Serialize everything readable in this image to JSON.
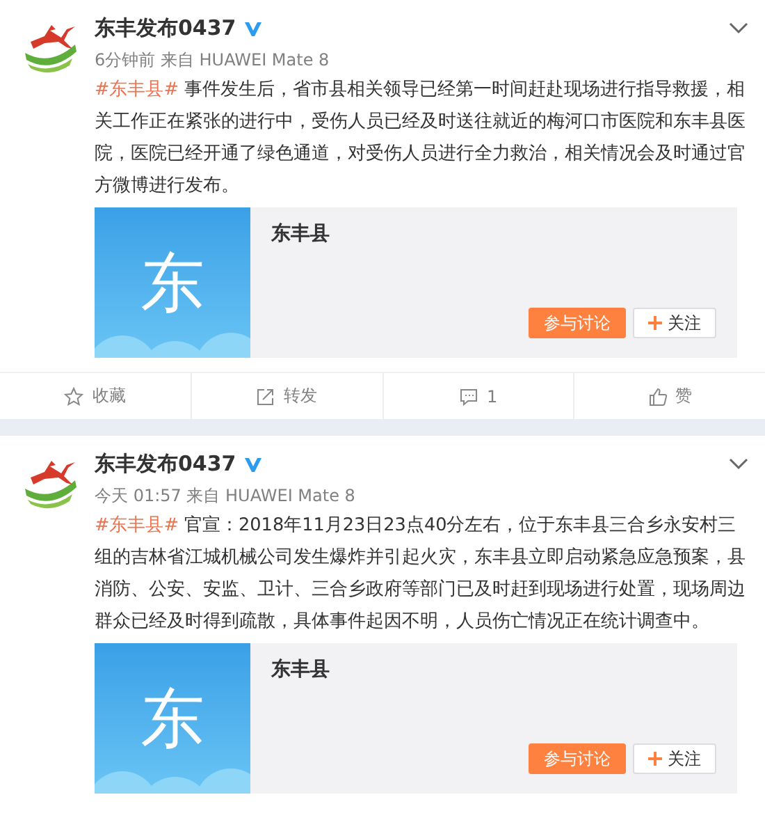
{
  "posts": [
    {
      "author": "东丰发布0437",
      "verified": true,
      "meta": "6分钟前 来自 HUAWEI Mate 8",
      "topic": "#东丰县#",
      "text": " 事件发生后，省市县相关领导已经第一时间赶赴现场进行指导救援，相关工作正在紧张的进行中，受伤人员已经及时送往就近的梅河口市医院和东丰县医院，医院已经开通了绿色通道，对受伤人员进行全力救治，相关情况会及时通过官方微博进行发布。",
      "card": {
        "glyph": "东",
        "title": "东丰县",
        "discuss": "参与讨论",
        "follow": "关注"
      },
      "actions": [
        {
          "kind": "star",
          "label": "收藏"
        },
        {
          "kind": "share",
          "label": "转发"
        },
        {
          "kind": "comment",
          "label": "1"
        },
        {
          "kind": "like",
          "label": "赞"
        }
      ]
    },
    {
      "author": "东丰发布0437",
      "verified": true,
      "meta": "今天 01:57 来自 HUAWEI Mate 8",
      "topic": "#东丰县#",
      "text": " 官宣：2018年11月23日23点40分左右，位于东丰县三合乡永安村三组的吉林省江城机械公司发生爆炸并引起火灾，东丰县立即启动紧急应急预案，县消防、公安、安监、卫计、三合乡政府等部门已及时赶到现场进行处置，现场周边群众已经及时得到疏散，具体事件起因不明，人员伤亡情况正在统计调查中。",
      "card": {
        "glyph": "东",
        "title": "东丰县",
        "discuss": "参与讨论",
        "follow": "关注"
      }
    }
  ]
}
